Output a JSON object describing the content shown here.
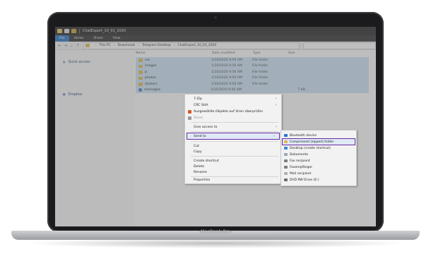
{
  "window": {
    "title": "ChatExport_10_01_2020",
    "ribbon_tabs": [
      "File",
      "Home",
      "Share",
      "View"
    ]
  },
  "address": {
    "crumbs": [
      "This PC",
      "Downloads",
      "Telegram Desktop",
      "ChatExport_10_01_2020"
    ]
  },
  "nav": {
    "quick_access": "Quick access",
    "dropbox": "Dropbox"
  },
  "columns": {
    "name": "Name",
    "date": "Date modified",
    "type": "Type",
    "size": "Size"
  },
  "files": [
    {
      "name": "css",
      "date": "1/10/2020 9:56 AM",
      "type": "File folder",
      "size": "",
      "kind": "folder"
    },
    {
      "name": "images",
      "date": "1/10/2020 9:56 AM",
      "type": "File folder",
      "size": "",
      "kind": "folder"
    },
    {
      "name": "js",
      "date": "1/10/2020 9:56 AM",
      "type": "File folder",
      "size": "",
      "kind": "folder"
    },
    {
      "name": "photos",
      "date": "1/10/2020 9:56 AM",
      "type": "File folder",
      "size": "",
      "kind": "folder"
    },
    {
      "name": "stickers",
      "date": "1/10/2020 9:56 AM",
      "type": "File folder",
      "size": "",
      "kind": "folder"
    },
    {
      "name": "messages",
      "date": "1/10/2020 9:56 AM",
      "type": "",
      "size": "7 KB",
      "kind": "file"
    }
  ],
  "context_menu": {
    "seven_zip": "7-Zip",
    "crc_sha": "CRC SHA",
    "scan": "Ausgewählte Objekte auf Viren überprüfen",
    "share": "Share",
    "give_access": "Give access to",
    "send_to": "Send to",
    "cut": "Cut",
    "copy": "Copy",
    "create_shortcut": "Create shortcut",
    "delete": "Delete",
    "rename": "Rename",
    "properties": "Properties"
  },
  "send_to_menu": [
    {
      "label": "Bluetooth device",
      "color": "#2a6fd0"
    },
    {
      "label": "Compressed (zipped) folder",
      "color": "#e1b84f"
    },
    {
      "label": "Desktop (create shortcut)",
      "color": "#3a8ad8"
    },
    {
      "label": "Dokumente",
      "color": "#9aa6b5"
    },
    {
      "label": "Fax recipient",
      "color": "#7d7d7d"
    },
    {
      "label": "Faxempfänger",
      "color": "#7d7d7d"
    },
    {
      "label": "Mail recipient",
      "color": "#b0b0b0"
    },
    {
      "label": "DVD RW Drive (E:)",
      "color": "#6b6b6b"
    }
  ],
  "device": {
    "brand": "MacBook Pro"
  },
  "colors": {
    "highlight_outline": "#6a2aa0",
    "selection": "#cce4f7",
    "accent": "#1e6fc2"
  }
}
